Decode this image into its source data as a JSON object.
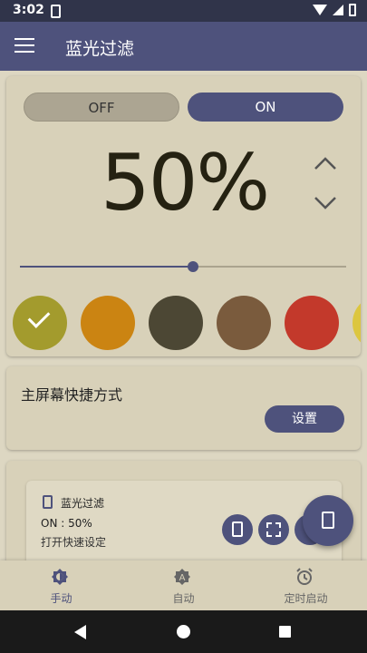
{
  "status_bar": {
    "time": "3:02"
  },
  "app_bar": {
    "title": "蓝光过滤",
    "menu_icon": "hamburger-menu-icon"
  },
  "filter": {
    "off_label": "OFF",
    "on_label": "ON",
    "active": "ON",
    "percent_text": "50%",
    "slider_value": 0.53,
    "swatches": [
      {
        "color": "#a39b2d",
        "selected": true
      },
      {
        "color": "#cb8412"
      },
      {
        "color": "#4c4734"
      },
      {
        "color": "#7a5b3d"
      },
      {
        "color": "#c3392b"
      },
      {
        "color": "#dcc63f"
      }
    ]
  },
  "shortcut": {
    "title": "主屏幕快捷方式",
    "button_label": "设置"
  },
  "widget": {
    "title": "蓝光过滤",
    "status": "ON : 50%",
    "subtitle": "打开快速设定"
  },
  "bottom_nav": [
    {
      "label": "手动",
      "icon": "brightness-icon",
      "active": true
    },
    {
      "label": "自动",
      "icon": "auto-brightness-icon"
    },
    {
      "label": "定时启动",
      "icon": "alarm-clock-icon"
    }
  ],
  "colors": {
    "primary": "#4e527c",
    "background": "#ddd7c2",
    "card": "#d8d1b9"
  }
}
